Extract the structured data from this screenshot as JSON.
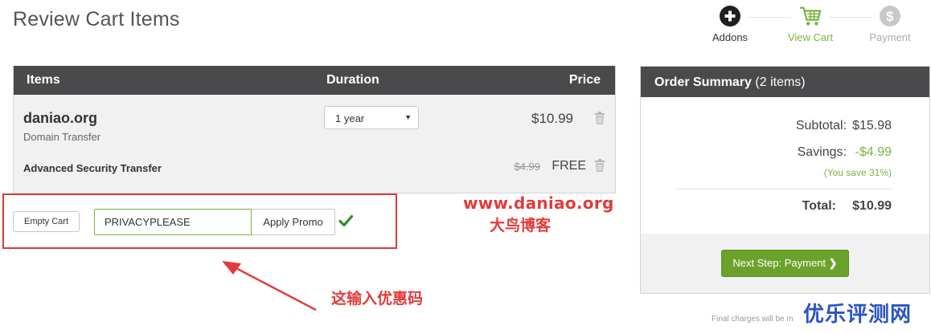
{
  "page": {
    "title": "Review Cart Items"
  },
  "steps": [
    {
      "label": "Addons",
      "icon": "plus-circle-icon",
      "state": "done"
    },
    {
      "label": "View Cart",
      "icon": "cart-icon",
      "state": "active"
    },
    {
      "label": "Payment",
      "icon": "dollar-icon",
      "state": "pending"
    }
  ],
  "cart": {
    "headers": {
      "items": "Items",
      "duration": "Duration",
      "price": "Price"
    },
    "item": {
      "domain": "daniao.org",
      "type": "Domain Transfer",
      "duration": "1 year",
      "price": "$10.99"
    },
    "addon": {
      "name": "Advanced Security Transfer",
      "old_price": "$4.99",
      "price": "FREE"
    }
  },
  "promo": {
    "empty_cart_label": "Empty Cart",
    "code_value": "PRIVACYPLEASE",
    "apply_label": "Apply Promo"
  },
  "annotations": {
    "watermark_url": "www.daniao.org",
    "watermark_name": "大鸟博客",
    "arrow_text": "这输入优惠码",
    "corner_watermark": "优乐评测网"
  },
  "summary": {
    "title": "Order Summary",
    "item_count": "(2 items)",
    "subtotal_label": "Subtotal:",
    "subtotal_value": "$15.98",
    "savings_label": "Savings:",
    "savings_value": "-$4.99",
    "savings_note": "(You save 31%)",
    "total_label": "Total:",
    "total_value": "$10.99",
    "next_label": "Next Step: Payment"
  },
  "footer": {
    "note": "Final charges will be m"
  },
  "colors": {
    "accent_green": "#7cb342",
    "header_dark": "#4a4a4c",
    "button_green": "#6aa22b",
    "annotation_red": "#e23b3b"
  }
}
